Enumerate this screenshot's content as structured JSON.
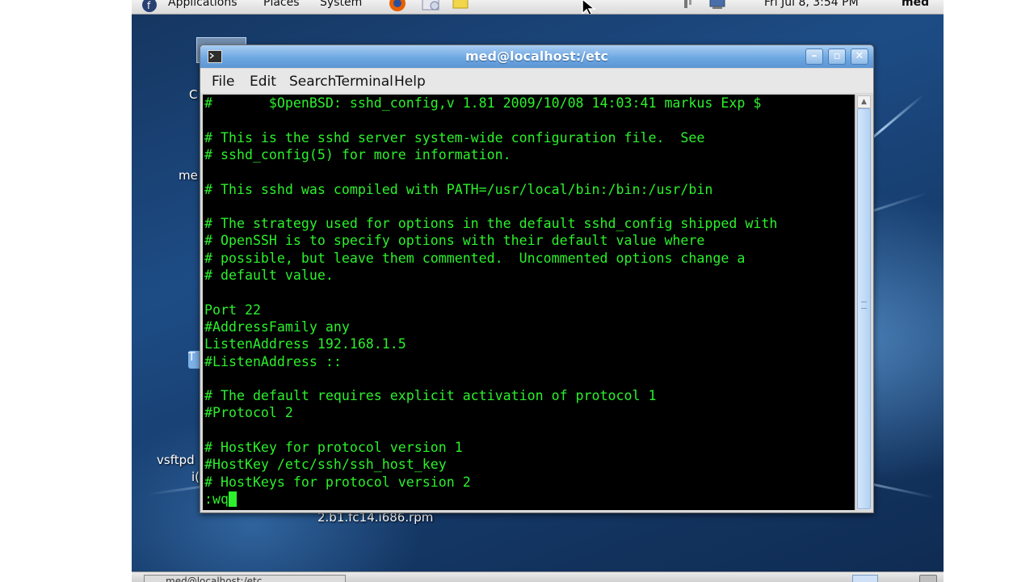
{
  "top_panel": {
    "menus": [
      "Applications",
      "Places",
      "System"
    ],
    "clock": "Fri Jul 8, 3:54 PM",
    "user": "med"
  },
  "desktop": {
    "labels": [
      "C",
      "me",
      "vsftpd",
      "i(",
      "2.b1.fc14.i686.rpm"
    ]
  },
  "terminal": {
    "title": "med@localhost:/etc",
    "menu": [
      "File",
      "Edit",
      "Search",
      "Terminal",
      "Help"
    ],
    "lines": [
      "#       $OpenBSD: sshd_config,v 1.81 2009/10/08 14:03:41 markus Exp $",
      "",
      "# This is the sshd server system-wide configuration file.  See",
      "# sshd_config(5) for more information.",
      "",
      "# This sshd was compiled with PATH=/usr/local/bin:/bin:/usr/bin",
      "",
      "# The strategy used for options in the default sshd_config shipped with",
      "# OpenSSH is to specify options with their default value where",
      "# possible, but leave them commented.  Uncommented options change a",
      "# default value.",
      "",
      "Port 22",
      "#AddressFamily any",
      "ListenAddress 192.168.1.5",
      "#ListenAddress ::",
      "",
      "# The default requires explicit activation of protocol 1",
      "#Protocol 2",
      "",
      "# HostKey for protocol version 1",
      "#HostKey /etc/ssh/ssh_host_key",
      "# HostKeys for protocol version 2"
    ],
    "command": ":wq"
  },
  "taskbar": {
    "task_label": "med@localhost:/etc"
  },
  "colors": {
    "terminal_fg": "#2cf02c",
    "terminal_bg": "#000000",
    "titlebar": "#6ea8e3"
  }
}
